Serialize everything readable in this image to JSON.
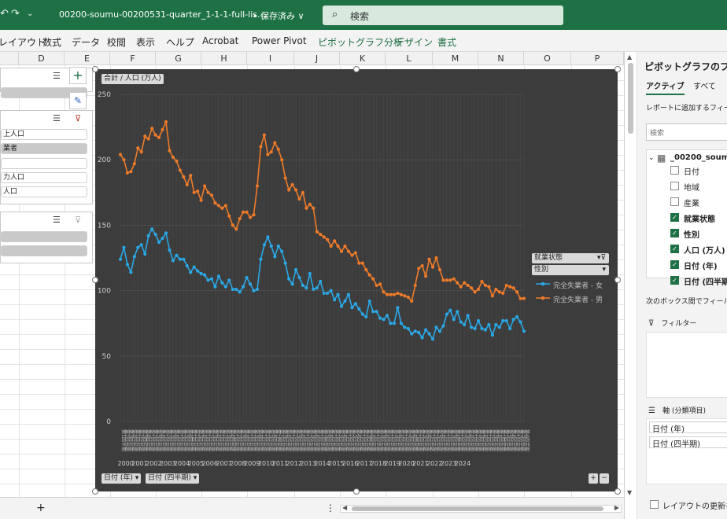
{
  "titlebar": {
    "doc_title": "00200-soumu-00200531-quarter_1-1-1-full-lis…",
    "save_state": "• 保存済み ∨",
    "search_placeholder": "検索",
    "undo_icon": "undo-icon",
    "redo_icon": "redo-icon"
  },
  "ribbon": {
    "tabs": [
      "レイアウト",
      "数式",
      "データ",
      "校閲",
      "表示",
      "ヘルプ",
      "Acrobat",
      "Power Pivot"
    ],
    "context_tabs": [
      "ピボットグラフ分析",
      "デザイン",
      "書式"
    ],
    "context_color": "#1e7145"
  },
  "sheet": {
    "columns": [
      "D",
      "E",
      "F",
      "G",
      "H",
      "I",
      "J",
      "K",
      "L",
      "M",
      "N",
      "O",
      "P"
    ]
  },
  "slicers": {
    "slicer2_items": [
      "上人口",
      "業者",
      "",
      "力人口",
      "人口"
    ]
  },
  "chart": {
    "value_field": "合計 / 人口 (万人)",
    "legend_field1": "就業状態",
    "legend_field2": "性別",
    "axis_field1": "日付 (年)",
    "axis_field2": "日付 (四半期)",
    "bg_color": "#3c3c3c"
  },
  "chart_data": {
    "type": "line",
    "title": "",
    "ylim": [
      0,
      250
    ],
    "yticks": [
      0,
      50,
      100,
      150,
      200,
      250
    ],
    "years": [
      "2000",
      "2001",
      "2002",
      "2003",
      "2004",
      "2005",
      "2006",
      "2007",
      "2008",
      "2009",
      "2010",
      "2011",
      "2012",
      "2013",
      "2014",
      "2015",
      "2016",
      "2017",
      "2018",
      "2019",
      "2020",
      "2021",
      "2022",
      "2023",
      "2024"
    ],
    "quarter_labels": [
      "第1四半期",
      "第2四半期",
      "第3四半期",
      "第4四半期"
    ],
    "series": [
      {
        "name": "完全失業者 - 女",
        "color": "#2aa8e6",
        "values": [
          124,
          133,
          120,
          114,
          126,
          133,
          135,
          128,
          142,
          147,
          143,
          137,
          140,
          144,
          131,
          123,
          127,
          124,
          124,
          119,
          114,
          118,
          115,
          113,
          112,
          108,
          109,
          103,
          111,
          106,
          103,
          108,
          101,
          101,
          99,
          103,
          110,
          105,
          100,
          101,
          124,
          135,
          141,
          134,
          126,
          134,
          130,
          121,
          109,
          105,
          116,
          110,
          104,
          102,
          113,
          101,
          102,
          107,
          98,
          98,
          100,
          93,
          97,
          88,
          92,
          97,
          87,
          90,
          86,
          82,
          80,
          92,
          84,
          84,
          79,
          78,
          81,
          75,
          75,
          87,
          75,
          72,
          71,
          67,
          69,
          68,
          64,
          70,
          67,
          63,
          72,
          69,
          73,
          82,
          85,
          78,
          84,
          76,
          74,
          81,
          72,
          71,
          77,
          71,
          70,
          74,
          66,
          74,
          72,
          77,
          77,
          71,
          78,
          80,
          76,
          69
        ]
      },
      {
        "name": "完全失業者 - 男",
        "color": "#ee7b2a",
        "values": [
          204,
          200,
          190,
          191,
          197,
          209,
          206,
          218,
          216,
          224,
          219,
          217,
          223,
          229,
          207,
          202,
          199,
          192,
          187,
          181,
          188,
          175,
          176,
          169,
          180,
          175,
          173,
          167,
          165,
          163,
          165,
          157,
          150,
          147,
          155,
          160,
          160,
          156,
          158,
          180,
          210,
          219,
          204,
          206,
          213,
          208,
          200,
          186,
          177,
          181,
          177,
          170,
          175,
          163,
          166,
          163,
          145,
          143,
          141,
          139,
          134,
          138,
          134,
          130,
          134,
          130,
          127,
          129,
          121,
          121,
          116,
          112,
          109,
          104,
          105,
          99,
          97,
          97,
          97,
          98,
          97,
          96,
          95,
          92,
          104,
          117,
          119,
          111,
          124,
          118,
          125,
          116,
          108,
          108,
          108,
          109,
          106,
          103,
          106,
          104,
          102,
          99,
          101,
          107,
          104,
          103,
          96,
          101,
          99,
          98,
          104,
          103,
          102,
          99,
          94,
          94
        ]
      }
    ]
  },
  "fieldpane": {
    "title": "ピボットグラフのフィー",
    "tab_active": "アクティブ",
    "tab_all": "すべて",
    "hint": "レポートに追加するフィール",
    "search": "検索",
    "table_name": "_00200_soum",
    "fields": [
      {
        "label": "日付",
        "checked": false
      },
      {
        "label": "地域",
        "checked": false
      },
      {
        "label": "産業",
        "checked": false
      },
      {
        "label": "就業状態",
        "checked": true
      },
      {
        "label": "性別",
        "checked": true
      },
      {
        "label": "人口 (万人)",
        "checked": true
      },
      {
        "label": "日付 (年)",
        "checked": true
      },
      {
        "label": "日付 (四半期)",
        "checked": true
      }
    ],
    "drag_hint": "次のボックス間でフィールド",
    "filter_label": "フィルター",
    "axis_label": "軸 (分類項目)",
    "axis_items": [
      "日付 (年)",
      "日付 (四半期)"
    ],
    "defer_label": "レイアウトの更新を保"
  },
  "bottom": {
    "add_sheet": "+",
    "menu_dots": "⋮"
  }
}
